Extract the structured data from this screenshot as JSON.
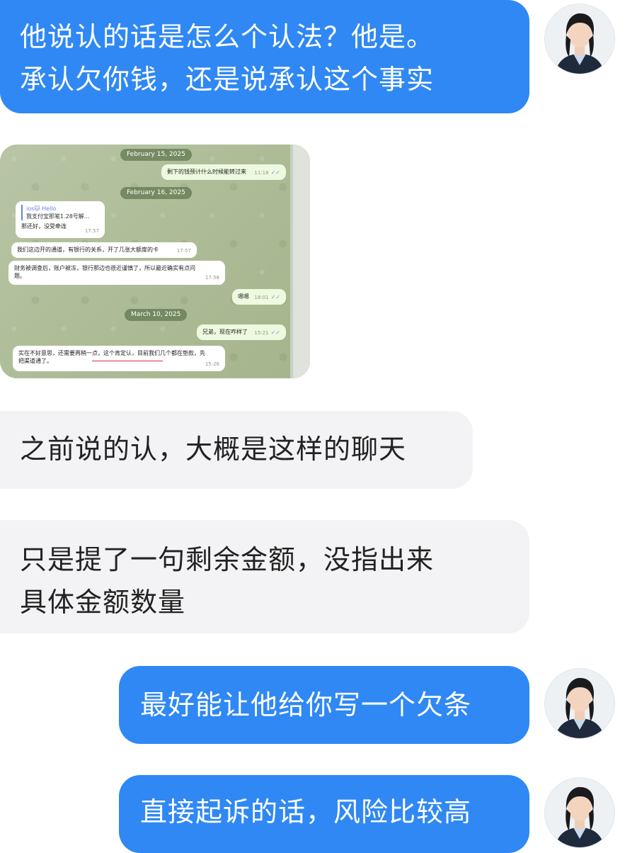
{
  "messages": [
    {
      "id": "m1",
      "side": "out",
      "lines": [
        "他说认的话是怎么个认法？他是。",
        "承认欠你钱，还是说承认这个事实"
      ]
    },
    {
      "id": "m2",
      "side": "in",
      "lines": [
        "之前说的认，大概是这样的聊天"
      ]
    },
    {
      "id": "m3",
      "side": "in",
      "lines": [
        "只是提了一句剩余金额，没指出来",
        "具体金额数量"
      ]
    },
    {
      "id": "m4",
      "side": "out",
      "lines": [
        "最好能让他给你写一个欠条"
      ]
    },
    {
      "id": "m5",
      "side": "out",
      "lines": [
        "直接起诉的话，风险比较高"
      ]
    }
  ],
  "screenshot": {
    "dates": [
      "February 15, 2025",
      "February 16, 2025",
      "March 10, 2025"
    ],
    "chat": [
      {
        "side": "out",
        "text": "剩下的钱预计什么时候能转过来",
        "time": "11:18"
      },
      {
        "side": "in",
        "quote_name": "ios🐱 Hello",
        "quote_text": "我支付宝那笔1.28号解...",
        "text": "那还好，没受牵连",
        "time": "17:57"
      },
      {
        "side": "in",
        "text": "我们这边开的通道，有银行的关系，开了几张大额度的卡",
        "time": "17:57"
      },
      {
        "side": "in",
        "text": "财务被调查后，账户被冻，银行那边也很近谨慎了，所以最近确实有点问",
        "text2": "题。",
        "time": "17:58"
      },
      {
        "side": "out",
        "text": "嗯嗯",
        "time": "18:01"
      },
      {
        "side": "out",
        "text": "兄弟，现在咋样了",
        "time": "15:21"
      },
      {
        "side": "in",
        "text": "实在不好意思，还需要再稍一点，这个肯定认，目前我们几个都在垫款，先",
        "text2": "把渠道通了。",
        "time": "15:26"
      }
    ]
  },
  "colors": {
    "outgoing": "#2f88f4",
    "incoming": "#f3f3f5"
  },
  "icons": {
    "avatar": "lawyer-avatar-icon",
    "checkmark": "double-check-icon"
  }
}
